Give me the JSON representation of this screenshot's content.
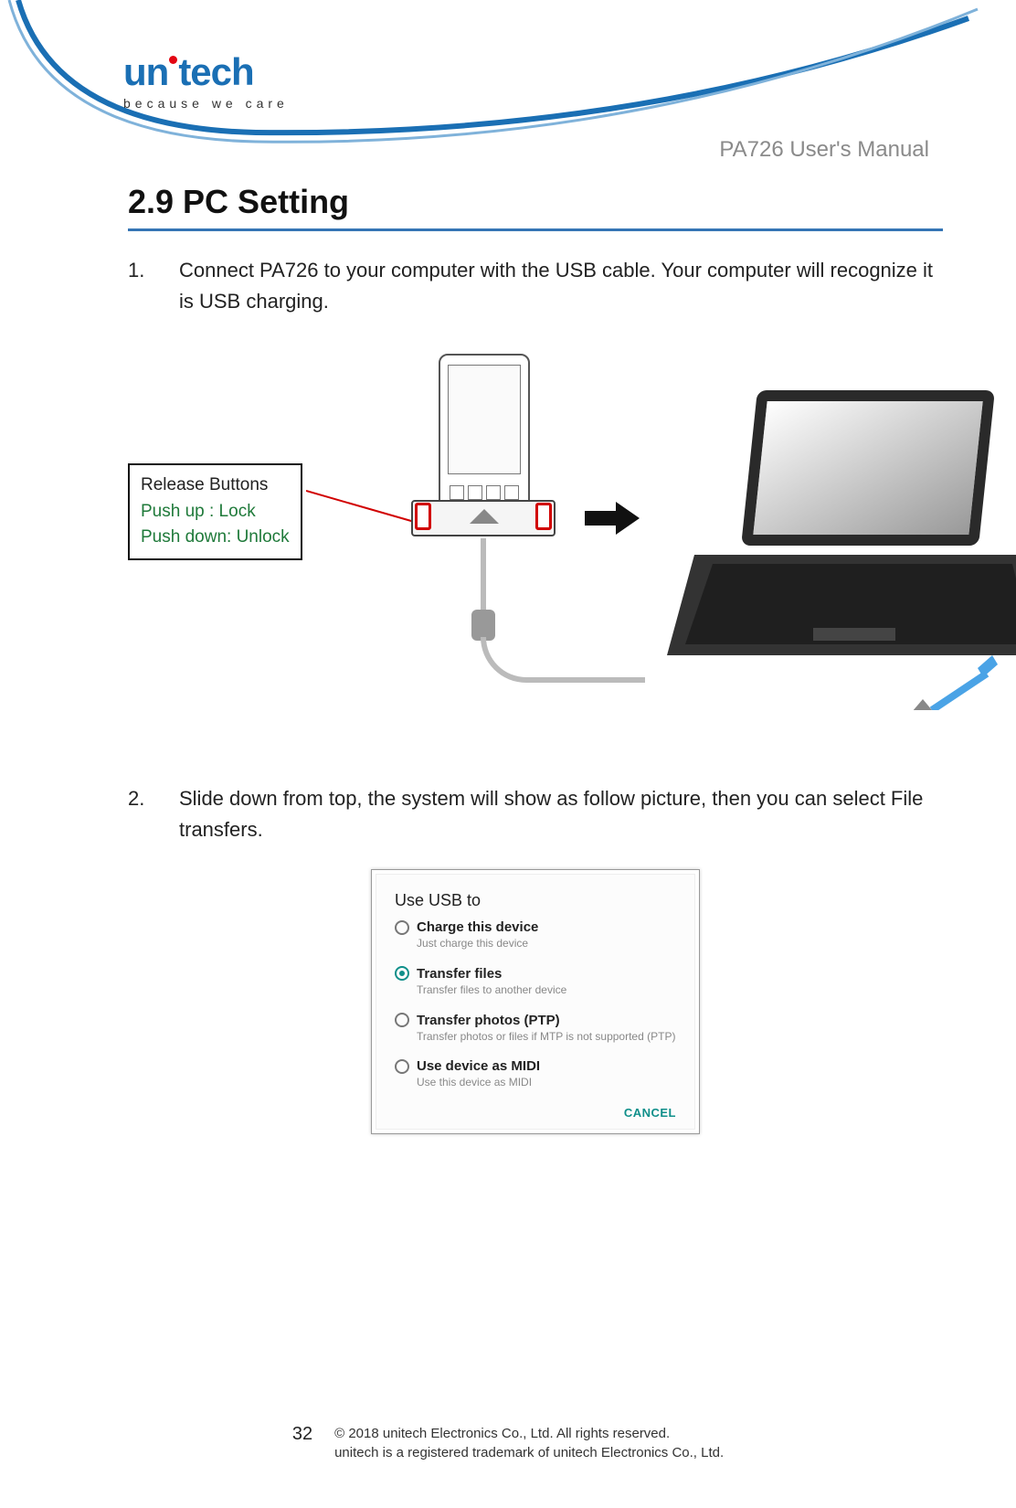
{
  "logo": {
    "word": "unitech",
    "tagline": "because we care"
  },
  "header": {
    "manual_title": "PA726 User's Manual"
  },
  "section": {
    "heading": "2.9 PC Setting"
  },
  "steps": [
    {
      "num": "1.",
      "text": "Connect PA726 to your computer with the USB cable. Your computer will recognize it is USB charging."
    },
    {
      "num": "2.",
      "text": "Slide down from top, the system will show as follow picture, then you can select File transfers."
    }
  ],
  "callout": {
    "title": "Release Buttons",
    "line1": "Push up : Lock",
    "line2": "Push down: Unlock"
  },
  "usb_dialog": {
    "title": "Use USB to",
    "options": [
      {
        "label": "Charge this device",
        "sub": "Just charge this device",
        "selected": false
      },
      {
        "label": "Transfer files",
        "sub": "Transfer files to another device",
        "selected": true
      },
      {
        "label": "Transfer photos (PTP)",
        "sub": "Transfer photos or files if MTP is not supported (PTP)",
        "selected": false
      },
      {
        "label": "Use device as MIDI",
        "sub": "Use this device as MIDI",
        "selected": false
      }
    ],
    "cancel": "CANCEL"
  },
  "footer": {
    "page": "32",
    "copyright": "© 2018 unitech Electronics Co., Ltd. All rights reserved.",
    "trademark": "unitech is a registered trademark of unitech Electronics Co., Ltd."
  }
}
